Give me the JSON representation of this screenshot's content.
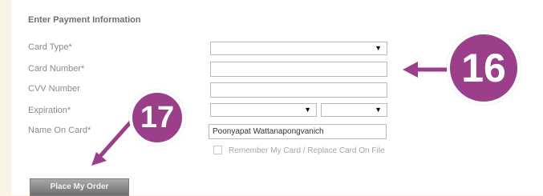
{
  "form": {
    "title": "Enter Payment Information",
    "labels": {
      "card_type": "Card Type*",
      "card_number": "Card Number*",
      "cvv": "CVV Number",
      "expiration": "Expiration*",
      "name_on_card": "Name On Card*"
    },
    "name_on_card_value": "Poonyapat Wattanapongvanich",
    "select_arrow": "▼",
    "remember_label": "Remember My Card / Replace Card On File",
    "place_order_label": "Place My Order"
  },
  "annotations": {
    "callout_16": "16",
    "callout_17": "17"
  },
  "colors": {
    "callout": "#9b3f8a",
    "background": "#fbf3e6"
  }
}
